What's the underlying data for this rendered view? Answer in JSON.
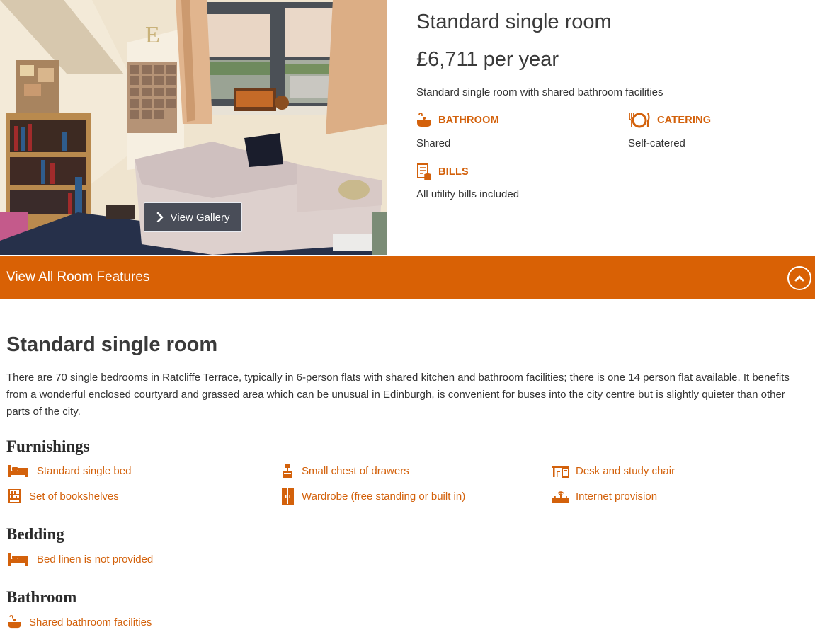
{
  "room": {
    "title": "Standard single room",
    "price": "£6,711 per year",
    "description": "Standard single room with shared bathroom facilities",
    "gallery_button": "View Gallery"
  },
  "features": {
    "bathroom": {
      "label": "BATHROOM",
      "value": "Shared",
      "icon": "bath-icon"
    },
    "catering": {
      "label": "CATERING",
      "value": "Self-catered",
      "icon": "plate-cutlery-icon"
    },
    "bills": {
      "label": "BILLS",
      "value": "All utility bills included",
      "icon": "bill-icon"
    }
  },
  "features_bar": {
    "link": "View All Room Features",
    "icon": "chevron-up-icon"
  },
  "details": {
    "title": "Standard single room",
    "paragraph": "There are 70 single bedrooms in Ratcliffe Terrace, typically in 6-person flats with shared kitchen and bathroom facilities; there is one 14 person flat available. It benefits from a wonderful enclosed courtyard and grassed area which can be unusual in Edinburgh, is convenient for buses into the city centre but is slightly quieter than other parts of the city.",
    "furnishings": {
      "heading": "Furnishings",
      "items": [
        {
          "label": "Standard single bed",
          "icon": "bed-icon"
        },
        {
          "label": "Small chest of drawers",
          "icon": "drawers-icon"
        },
        {
          "label": "Desk and study chair",
          "icon": "desk-icon"
        },
        {
          "label": "Set of bookshelves",
          "icon": "bookshelf-icon"
        },
        {
          "label": "Wardrobe (free standing or built in)",
          "icon": "wardrobe-icon"
        },
        {
          "label": "Internet provision",
          "icon": "router-icon"
        }
      ]
    },
    "bedding": {
      "heading": "Bedding",
      "items": [
        {
          "label": "Bed linen is not provided",
          "icon": "bed-icon"
        }
      ]
    },
    "bathroom": {
      "heading": "Bathroom",
      "items": [
        {
          "label": "Shared bathroom facilities",
          "icon": "bath-icon"
        }
      ]
    }
  },
  "colors": {
    "accent": "#d96105",
    "accent_text": "#d3610b",
    "text": "#333333",
    "button_bg": "#343a48"
  }
}
